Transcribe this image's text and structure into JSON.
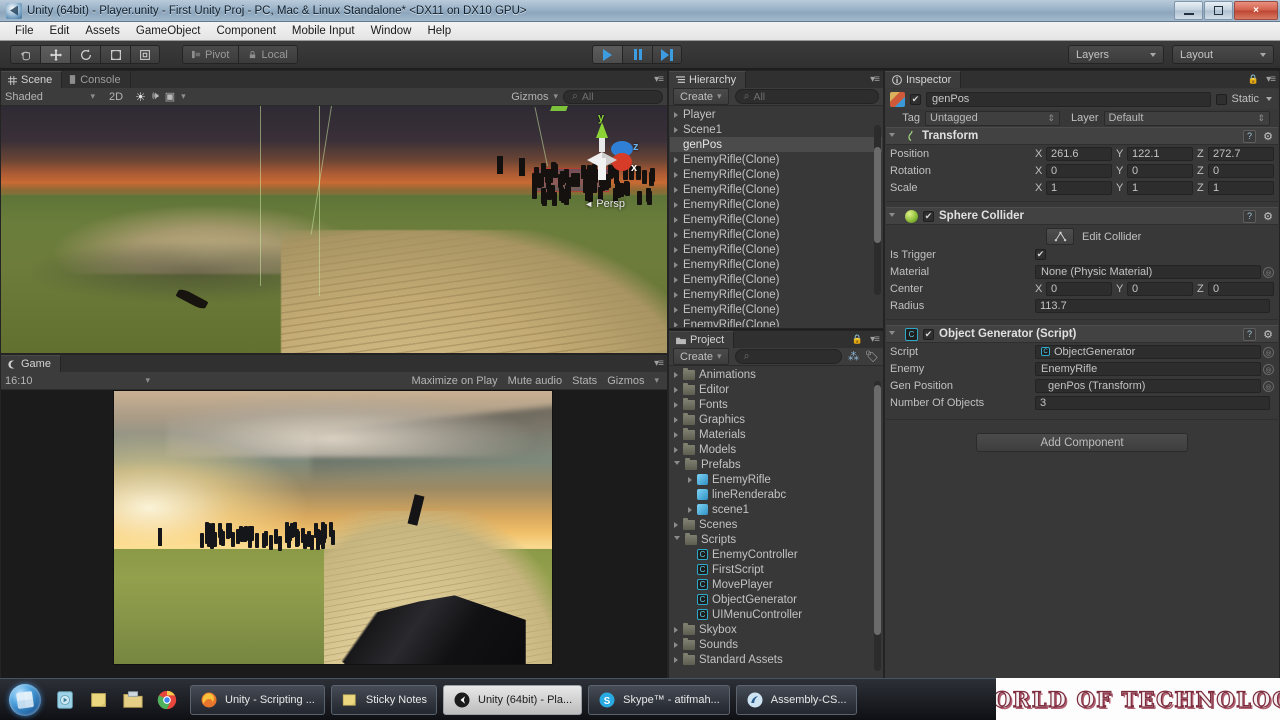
{
  "window": {
    "title": "Unity (64bit) - Player.unity - First Unity Proj - PC, Mac & Linux Standalone* <DX11 on DX10 GPU>",
    "icon": "unity-icon",
    "minimize": "minimize-icon",
    "maximize": "restore-icon",
    "close": "×"
  },
  "menubar": {
    "items": [
      "File",
      "Edit",
      "Assets",
      "GameObject",
      "Component",
      "Mobile Input",
      "Window",
      "Help"
    ]
  },
  "toolbar": {
    "tools": [
      {
        "name": "hand-tool",
        "glyph": "hand"
      },
      {
        "name": "move-tool",
        "glyph": "move",
        "active": true
      },
      {
        "name": "rotate-tool",
        "glyph": "rotate"
      },
      {
        "name": "scale-tool",
        "glyph": "scale"
      },
      {
        "name": "rect-tool",
        "glyph": "rect"
      }
    ],
    "pivot_label": "Pivot",
    "local_label": "Local",
    "play_label": "play-button",
    "pause_label": "pause-button",
    "step_label": "step-button",
    "layers_label": "Layers",
    "layout_label": "Layout"
  },
  "scene": {
    "tabs": [
      {
        "label": "Scene",
        "active": true
      },
      {
        "label": "Console",
        "active": false
      }
    ],
    "shading": "Shaded",
    "mode_2d": "2D",
    "gizmos_label": "Gizmos",
    "search_placeholder": "All",
    "gizmo_axes": {
      "x": "x",
      "y": "y",
      "z": "z"
    },
    "projection": "Persp"
  },
  "game": {
    "tabs": [
      {
        "label": "Game",
        "active": true
      }
    ],
    "aspect": "16:10",
    "maximize_label": "Maximize on Play",
    "mute_label": "Mute audio",
    "stats_label": "Stats",
    "gizmos_label": "Gizmos"
  },
  "hierarchy": {
    "tab": "Hierarchy",
    "create_label": "Create",
    "search_placeholder": "All",
    "items": [
      {
        "label": "Player",
        "expandable": true,
        "selected": false
      },
      {
        "label": "Scene1",
        "expandable": true,
        "selected": false
      },
      {
        "label": "genPos",
        "expandable": false,
        "selected": true
      },
      {
        "label": "EnemyRifle(Clone)",
        "expandable": true,
        "selected": false
      },
      {
        "label": "EnemyRifle(Clone)",
        "expandable": true,
        "selected": false
      },
      {
        "label": "EnemyRifle(Clone)",
        "expandable": true,
        "selected": false
      },
      {
        "label": "EnemyRifle(Clone)",
        "expandable": true,
        "selected": false
      },
      {
        "label": "EnemyRifle(Clone)",
        "expandable": true,
        "selected": false
      },
      {
        "label": "EnemyRifle(Clone)",
        "expandable": true,
        "selected": false
      },
      {
        "label": "EnemyRifle(Clone)",
        "expandable": true,
        "selected": false
      },
      {
        "label": "EnemyRifle(Clone)",
        "expandable": true,
        "selected": false
      },
      {
        "label": "EnemyRifle(Clone)",
        "expandable": true,
        "selected": false
      },
      {
        "label": "EnemyRifle(Clone)",
        "expandable": true,
        "selected": false
      },
      {
        "label": "EnemyRifle(Clone)",
        "expandable": true,
        "selected": false
      },
      {
        "label": "EnemyRifle(Clone)",
        "expandable": true,
        "selected": false
      }
    ]
  },
  "project": {
    "tab": "Project",
    "create_label": "Create",
    "search_placeholder": "",
    "items": [
      {
        "label": "Animations",
        "type": "folder",
        "indent": 0,
        "expandable": true,
        "open": false
      },
      {
        "label": "Editor",
        "type": "folder",
        "indent": 0,
        "expandable": true,
        "open": false
      },
      {
        "label": "Fonts",
        "type": "folder",
        "indent": 0,
        "expandable": true,
        "open": false
      },
      {
        "label": "Graphics",
        "type": "folder",
        "indent": 0,
        "expandable": true,
        "open": false
      },
      {
        "label": "Materials",
        "type": "folder",
        "indent": 0,
        "expandable": true,
        "open": false
      },
      {
        "label": "Models",
        "type": "folder",
        "indent": 0,
        "expandable": true,
        "open": false
      },
      {
        "label": "Prefabs",
        "type": "folder",
        "indent": 0,
        "expandable": true,
        "open": true
      },
      {
        "label": "EnemyRifle",
        "type": "prefab",
        "indent": 1,
        "expandable": true,
        "open": false
      },
      {
        "label": "lineRenderabc",
        "type": "prefab",
        "indent": 1,
        "expandable": false,
        "open": false
      },
      {
        "label": "scene1",
        "type": "prefab",
        "indent": 1,
        "expandable": true,
        "open": false
      },
      {
        "label": "Scenes",
        "type": "folder",
        "indent": 0,
        "expandable": true,
        "open": false
      },
      {
        "label": "Scripts",
        "type": "folder",
        "indent": 0,
        "expandable": true,
        "open": true
      },
      {
        "label": "EnemyController",
        "type": "script",
        "indent": 1,
        "expandable": false,
        "open": false
      },
      {
        "label": "FirstScript",
        "type": "script",
        "indent": 1,
        "expandable": false,
        "open": false
      },
      {
        "label": "MovePlayer",
        "type": "script",
        "indent": 1,
        "expandable": false,
        "open": false
      },
      {
        "label": "ObjectGenerator",
        "type": "script",
        "indent": 1,
        "expandable": false,
        "open": false
      },
      {
        "label": "UIMenuController",
        "type": "script",
        "indent": 1,
        "expandable": false,
        "open": false
      },
      {
        "label": "Skybox",
        "type": "folder",
        "indent": 0,
        "expandable": true,
        "open": false
      },
      {
        "label": "Sounds",
        "type": "folder",
        "indent": 0,
        "expandable": true,
        "open": false
      },
      {
        "label": "Standard Assets",
        "type": "folder",
        "indent": 0,
        "expandable": true,
        "open": false
      }
    ]
  },
  "inspector": {
    "tab": "Inspector",
    "object_name": "genPos",
    "object_enabled": "✔",
    "static_label": "Static",
    "tag_label": "Tag",
    "tag_value": "Untagged",
    "layer_label": "Layer",
    "layer_value": "Default",
    "components": [
      {
        "name": "Transform",
        "enabled": null,
        "icon": "transform-icon",
        "rows": [
          {
            "label": "Position",
            "type": "vector3",
            "x": "261.6",
            "y": "122.1",
            "z": "272.7"
          },
          {
            "label": "Rotation",
            "type": "vector3",
            "x": "0",
            "y": "0",
            "z": "0"
          },
          {
            "label": "Scale",
            "type": "vector3",
            "x": "1",
            "y": "1",
            "z": "1"
          }
        ]
      },
      {
        "name": "Sphere Collider",
        "enabled": "✔",
        "icon": "sphere-collider-icon",
        "edit_collider_label": "Edit Collider",
        "rows": [
          {
            "label": "Is Trigger",
            "type": "checkbox",
            "value": "✔"
          },
          {
            "label": "Material",
            "type": "object",
            "value": "None (Physic Material)"
          },
          {
            "label": "Center",
            "type": "vector3",
            "x": "0",
            "y": "0",
            "z": "0"
          },
          {
            "label": "Radius",
            "type": "text",
            "value": "113.7"
          }
        ]
      },
      {
        "name": "Object Generator (Script)",
        "enabled": "✔",
        "icon": "script-icon",
        "rows": [
          {
            "label": "Script",
            "type": "object-script",
            "value": "ObjectGenerator"
          },
          {
            "label": "Enemy",
            "type": "object",
            "value": "EnemyRifle"
          },
          {
            "label": "Gen Position",
            "type": "object",
            "value": "genPos (Transform)"
          },
          {
            "label": "Number Of Objects",
            "type": "text",
            "value": "3"
          }
        ]
      }
    ],
    "add_component_label": "Add Component"
  },
  "taskbar": {
    "start_label": "start-orb",
    "quick_icons": [
      "media-player-icon",
      "sticky-notes-icon",
      "explorer-icon",
      "chrome-icon"
    ],
    "tasks": [
      {
        "label": "Unity - Scripting ...",
        "icon": "firefox-icon",
        "active": false
      },
      {
        "label": "Sticky Notes",
        "icon": "sticky-notes-icon",
        "active": false
      },
      {
        "label": "Unity (64bit) - Pla...",
        "icon": "unity-icon",
        "active": true
      },
      {
        "label": "Skype™ - atifmah...",
        "icon": "skype-icon",
        "active": false
      },
      {
        "label": "Assembly-CS...",
        "icon": "monodevelop-icon",
        "active": false
      }
    ],
    "watermark": "WORLD OF TECHNOLOGY"
  }
}
